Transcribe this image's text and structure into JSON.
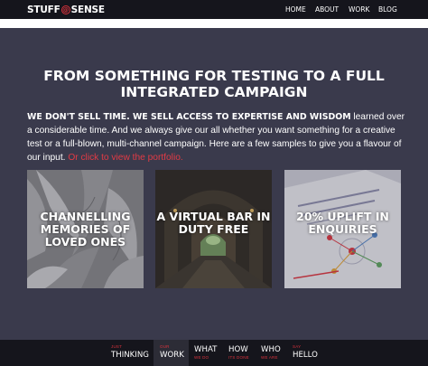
{
  "header": {
    "logo_left": "STUFF",
    "logo_symbol": "@",
    "logo_right": "SENSE",
    "nav": [
      "HOME",
      "ABOUT",
      "WORK",
      "BLOG"
    ]
  },
  "hero": {
    "title_line1": "FROM SOMETHING FOR TESTING TO A FULL",
    "title_line2": "INTEGRATED CAMPAIGN",
    "lead": "WE DON'T SELL TIME. WE SELL ACCESS TO EXPERTISE AND WISDOM",
    "body": " learned over a considerable time. And we always give our all whether you want something for a creative test or a full-blown, multi-channel campaign. Here are a few samples to give you a flavour of our input. ",
    "cta": "Or click to view the portfolio."
  },
  "cards": [
    {
      "title": "CHANNELLING MEMORIES OF LOVED ONES",
      "image": "paper-leaves-sculpture"
    },
    {
      "title": "A VIRTUAL BAR IN DUTY FREE",
      "image": "cellar-tunnel"
    },
    {
      "title": "20% UPLIFT IN ENQUIRIES",
      "image": "brochure-diagram"
    }
  ],
  "bottom_nav": [
    {
      "small": "JUST",
      "big": "THINKING",
      "active": false
    },
    {
      "small": "OUR",
      "big": "WORK",
      "active": true
    },
    {
      "small": "WE DO",
      "big": "WHAT",
      "active": false
    },
    {
      "small": "ITS DONE",
      "big": "HOW",
      "active": false
    },
    {
      "small": "WE ARE",
      "big": "WHO",
      "active": false
    },
    {
      "small": "SAY",
      "big": "HELLO",
      "active": false
    }
  ],
  "colors": {
    "accent": "#d9323c",
    "background": "#3a3a4c",
    "bar": "#15151c"
  }
}
